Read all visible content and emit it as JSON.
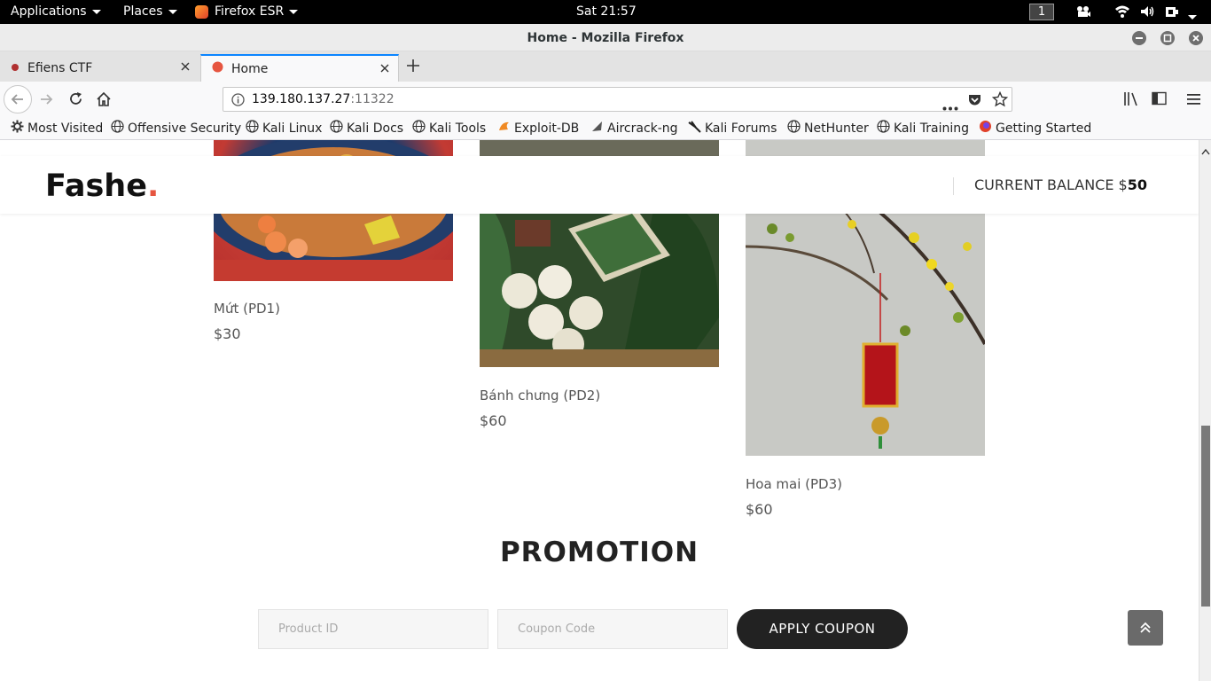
{
  "panel": {
    "applications": "Applications",
    "places": "Places",
    "firefox": "Firefox ESR",
    "clock": "Sat 21:57",
    "workspace": "1"
  },
  "window": {
    "title": "Home - Mozilla Firefox"
  },
  "tabs": [
    {
      "label": "Efiens CTF",
      "active": false
    },
    {
      "label": "Home",
      "active": true
    }
  ],
  "urlbar": {
    "host": "139.180.137.27",
    "port": ":11322"
  },
  "bookmarks": [
    {
      "label": "Most Visited",
      "icon": "gear-icon"
    },
    {
      "label": "Offensive Security",
      "icon": "globe-icon"
    },
    {
      "label": "Kali Linux",
      "icon": "globe-icon"
    },
    {
      "label": "Kali Docs",
      "icon": "globe-icon"
    },
    {
      "label": "Kali Tools",
      "icon": "globe-icon"
    },
    {
      "label": "Exploit-DB",
      "icon": "exploitdb-icon"
    },
    {
      "label": "Aircrack-ng",
      "icon": "aircrack-icon"
    },
    {
      "label": "Kali Forums",
      "icon": "kali-dragon-icon"
    },
    {
      "label": "NetHunter",
      "icon": "globe-icon"
    },
    {
      "label": "Kali Training",
      "icon": "globe-icon"
    },
    {
      "label": "Getting Started",
      "icon": "firefox-icon"
    }
  ],
  "site": {
    "logo": "Fashe",
    "logo_dot": ".",
    "balance_label": "CURRENT BALANCE $",
    "balance_value": "50",
    "accent": "#e65540"
  },
  "products": [
    {
      "name": "Mứt (PD1)",
      "price": "$30"
    },
    {
      "name": "Bánh chưng (PD2)",
      "price": "$60"
    },
    {
      "name": "Hoa mai (PD3)",
      "price": "$60"
    }
  ],
  "promotion": {
    "title": "PROMOTION",
    "product_placeholder": "Product ID",
    "coupon_placeholder": "Coupon Code",
    "apply_label": "APPLY COUPON"
  }
}
